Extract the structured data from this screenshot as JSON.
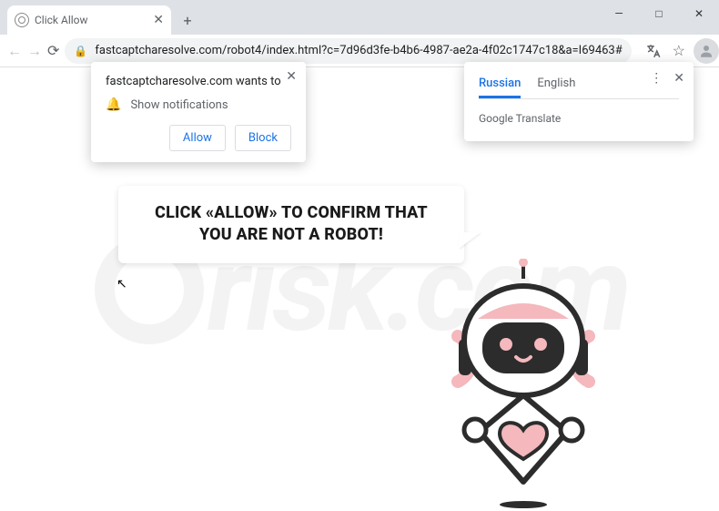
{
  "window": {
    "min": "—",
    "max": "□",
    "close": "✕"
  },
  "tab": {
    "title": "Click Allow"
  },
  "toolbar": {
    "url": "fastcaptcharesolve.com/robot4/index.html?c=7d96d3fe-b4b6-4987-ae2a-4f02c1747c18&a=I69463#"
  },
  "perm": {
    "title": "fastcaptcharesolve.com wants to",
    "line": "Show notifications",
    "allow": "Allow",
    "block": "Block"
  },
  "translate": {
    "tab_a": "Russian",
    "tab_b": "English",
    "body": "Google Translate"
  },
  "speech": {
    "text": "CLICK «ALLOW» TO CONFIRM THAT YOU ARE NOT A ROBOT!"
  },
  "watermark": {
    "tail": "risk.com"
  }
}
